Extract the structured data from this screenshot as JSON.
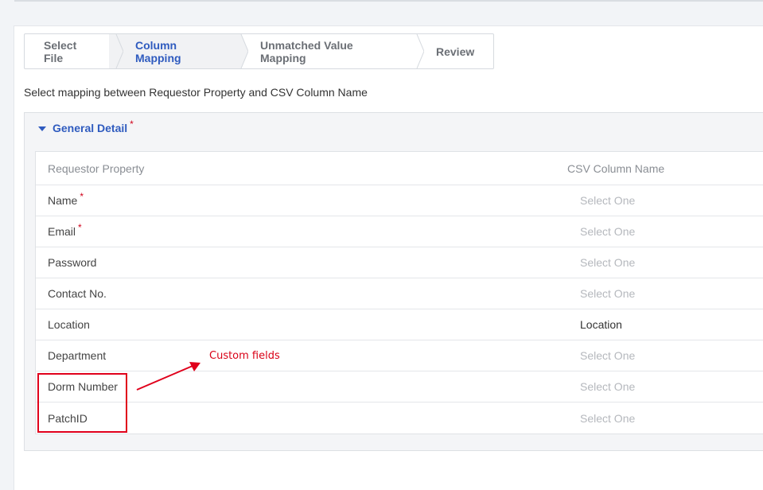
{
  "wizard": {
    "steps": [
      {
        "label": "Select File",
        "active": false
      },
      {
        "label": "Column Mapping",
        "active": true
      },
      {
        "label": "Unmatched Value Mapping",
        "active": false
      },
      {
        "label": "Review",
        "active": false
      }
    ]
  },
  "instructions": "Select mapping between Requestor Property and CSV Column Name",
  "section": {
    "title": "General Detail",
    "required_marker": "*"
  },
  "table": {
    "headers": {
      "property": "Requestor Property",
      "csv": "CSV Column Name"
    },
    "rows": [
      {
        "property": "Name",
        "required": "*",
        "csv": "Select One",
        "placeholder": true
      },
      {
        "property": "Email",
        "required": "*",
        "csv": "Select One",
        "placeholder": true
      },
      {
        "property": "Password",
        "required": "",
        "csv": "Select One",
        "placeholder": true
      },
      {
        "property": "Contact No.",
        "required": "",
        "csv": "Select One",
        "placeholder": true
      },
      {
        "property": "Location",
        "required": "",
        "csv": "Location",
        "placeholder": false
      },
      {
        "property": "Department",
        "required": "",
        "csv": "Select One",
        "placeholder": true
      },
      {
        "property": "Dorm Number",
        "required": "",
        "csv": "Select One",
        "placeholder": true
      },
      {
        "property": "PatchID",
        "required": "",
        "csv": "Select One",
        "placeholder": true
      }
    ]
  },
  "annotation": {
    "label": "Custom fields",
    "color": "#d90016"
  },
  "colors": {
    "accent": "#2f5bbf",
    "required": "#d0021b"
  }
}
